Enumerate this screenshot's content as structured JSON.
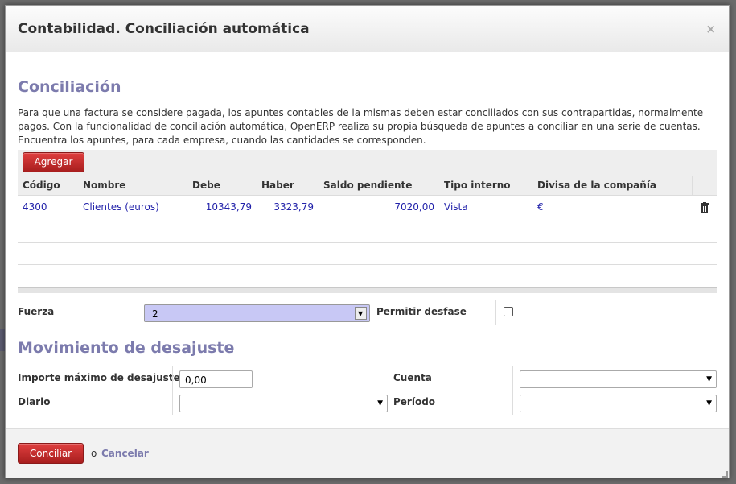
{
  "dialog": {
    "title": "Contabilidad. Conciliación automática",
    "close_glyph": "×"
  },
  "reconcile": {
    "section_title": "Conciliación",
    "description": "Para que una factura se considere pagada, los apuntes contables de la mismas deben estar conciliados con sus contrapartidas, normalmente pagos. Con la funcionalidad de conciliación automática, OpenERP realiza su propia búsqueda de apuntes a conciliar en una serie de cuentas. Encuentra los apuntes, para cada empresa, cuando las cantidades se corresponden.",
    "add_label": "Agregar",
    "columns": [
      "Código",
      "Nombre",
      "Debe",
      "Haber",
      "Saldo pendiente",
      "Tipo interno",
      "Divisa de la compañía"
    ],
    "rows": [
      {
        "codigo": "4300",
        "nombre": "Clientes (euros)",
        "debe": "10343,79",
        "haber": "3323,79",
        "saldo": "7020,00",
        "tipo": "Vista",
        "divisa": "€"
      }
    ],
    "delete_icon": "trash-icon"
  },
  "options": {
    "fuerza_label": "Fuerza",
    "fuerza_value": "2",
    "desfase_label": "Permitir desfase",
    "desfase_checked": false
  },
  "writeoff": {
    "section_title": "Movimiento de desajuste",
    "importe_label": "Importe máximo de desajuste",
    "importe_value": "0,00",
    "cuenta_label": "Cuenta",
    "cuenta_value": "",
    "diario_label": "Diario",
    "diario_value": "",
    "periodo_label": "Período",
    "periodo_value": ""
  },
  "footer": {
    "conciliar_label": "Conciliar",
    "or_text": "o",
    "cancel_label": "Cancelar"
  },
  "colors": {
    "accent": "#7c7bad",
    "button_red": "#c02a2a",
    "link_blue": "#2222aa",
    "selected_field": "#c8c8f5"
  }
}
